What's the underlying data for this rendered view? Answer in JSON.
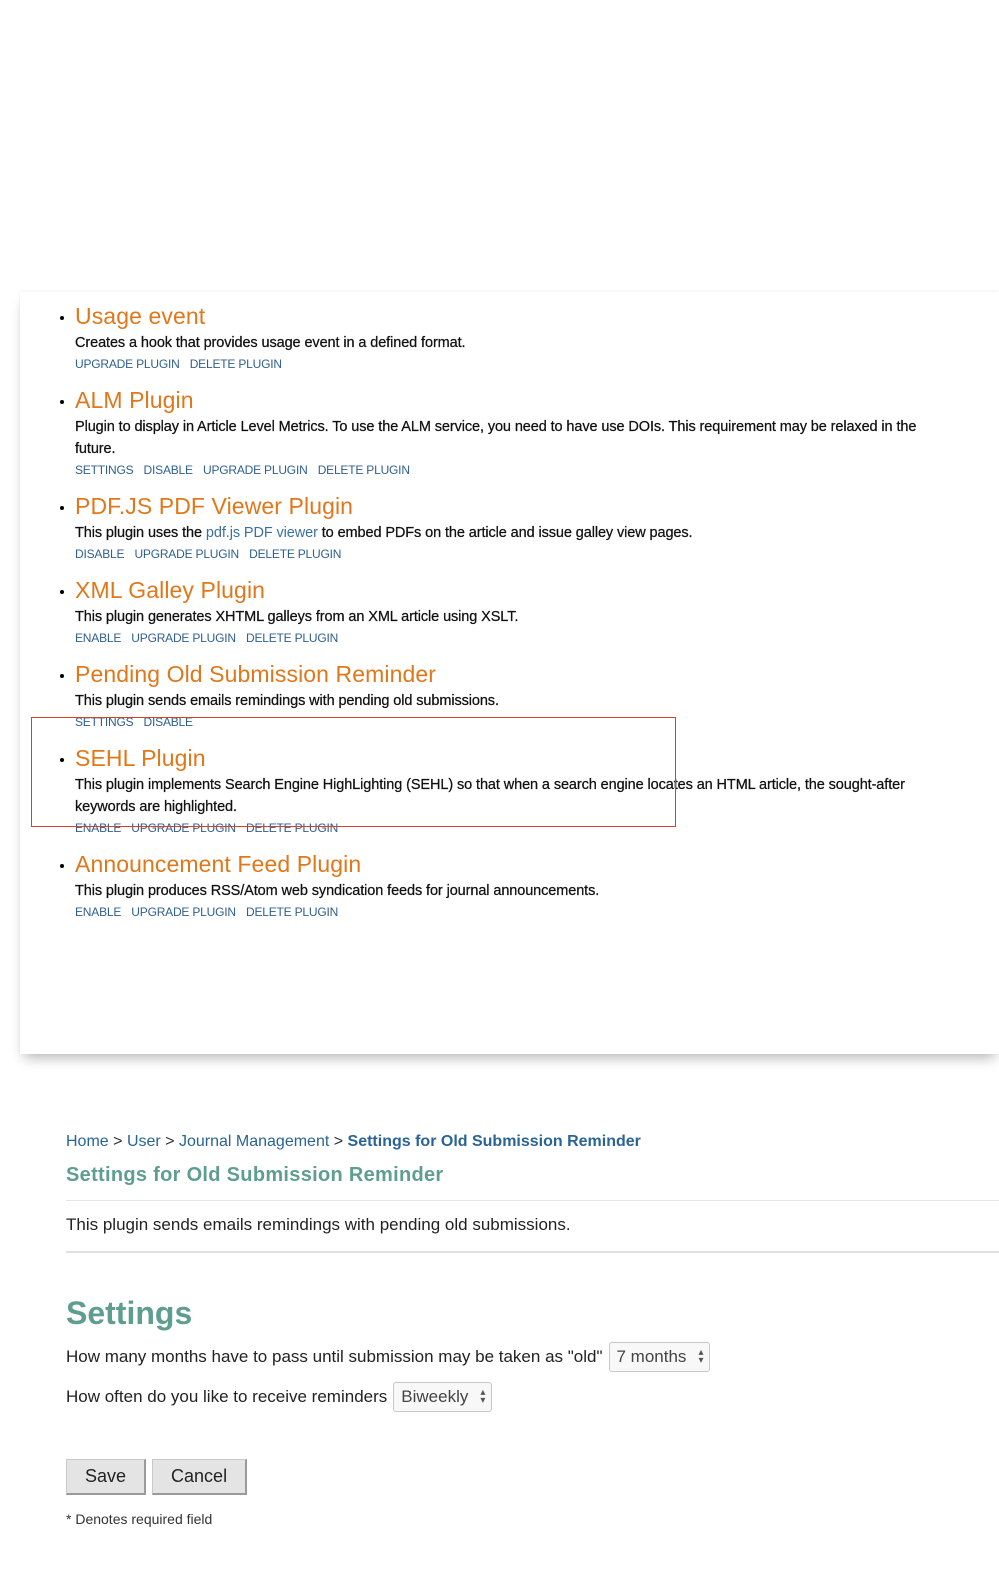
{
  "plugins": [
    {
      "title": "Usage event",
      "desc": "Creates a hook that provides usage event in a defined format.",
      "actions": [
        "UPGRADE PLUGIN",
        "DELETE PLUGIN"
      ]
    },
    {
      "title": "ALM Plugin",
      "desc": "Plugin to display in Article Level Metrics. To use the ALM service, you need to have use DOIs. This requirement may be relaxed in the future.",
      "actions": [
        "SETTINGS",
        "DISABLE",
        "UPGRADE PLUGIN",
        "DELETE PLUGIN"
      ]
    },
    {
      "title": "PDF.JS PDF Viewer Plugin",
      "desc_before": "This plugin uses the ",
      "desc_link": "pdf.js PDF viewer",
      "desc_after": " to embed PDFs on the article and issue galley view pages.",
      "actions": [
        "DISABLE",
        "UPGRADE PLUGIN",
        "DELETE PLUGIN"
      ]
    },
    {
      "title": "XML Galley Plugin",
      "desc": "This plugin generates XHTML galleys from an XML article using XSLT.",
      "actions": [
        "ENABLE",
        "UPGRADE PLUGIN",
        "DELETE PLUGIN"
      ]
    },
    {
      "title": "Pending Old Submission Reminder",
      "desc": "This plugin sends emails remindings with pending old submissions.",
      "actions": [
        "SETTINGS",
        "DISABLE"
      ]
    },
    {
      "title": "SEHL Plugin",
      "desc": "This plugin implements Search Engine HighLighting (SEHL) so that when a search engine locates an HTML article, the sought-after keywords are highlighted.",
      "actions": [
        "ENABLE",
        "UPGRADE PLUGIN",
        "DELETE PLUGIN"
      ]
    },
    {
      "title": "Announcement Feed Plugin",
      "desc": "This plugin produces RSS/Atom web syndication feeds for journal announcements.",
      "actions": [
        "ENABLE",
        "UPGRADE PLUGIN",
        "DELETE PLUGIN"
      ]
    }
  ],
  "breadcrumb": {
    "home": "Home",
    "user": "User",
    "journal_management": "Journal Management",
    "current": "Settings for Old Submission Reminder",
    "separator": ">"
  },
  "settings_page": {
    "heading": "Settings for Old Submission Reminder",
    "description": "This plugin sends emails remindings with pending old submissions.",
    "section_title": "Settings",
    "months_label": "How many months have to pass until submission may be taken as \"old\"",
    "months_value": "7 months",
    "frequency_label": "How often do you like to receive reminders",
    "frequency_value": "Biweekly",
    "save_label": "Save",
    "cancel_label": "Cancel",
    "required_note": "* Denotes required field"
  },
  "colors": {
    "plugin_title": "#e0781b",
    "link": "#2a6496",
    "heading": "#5e9e90",
    "highlight_border": "#d8402a"
  }
}
